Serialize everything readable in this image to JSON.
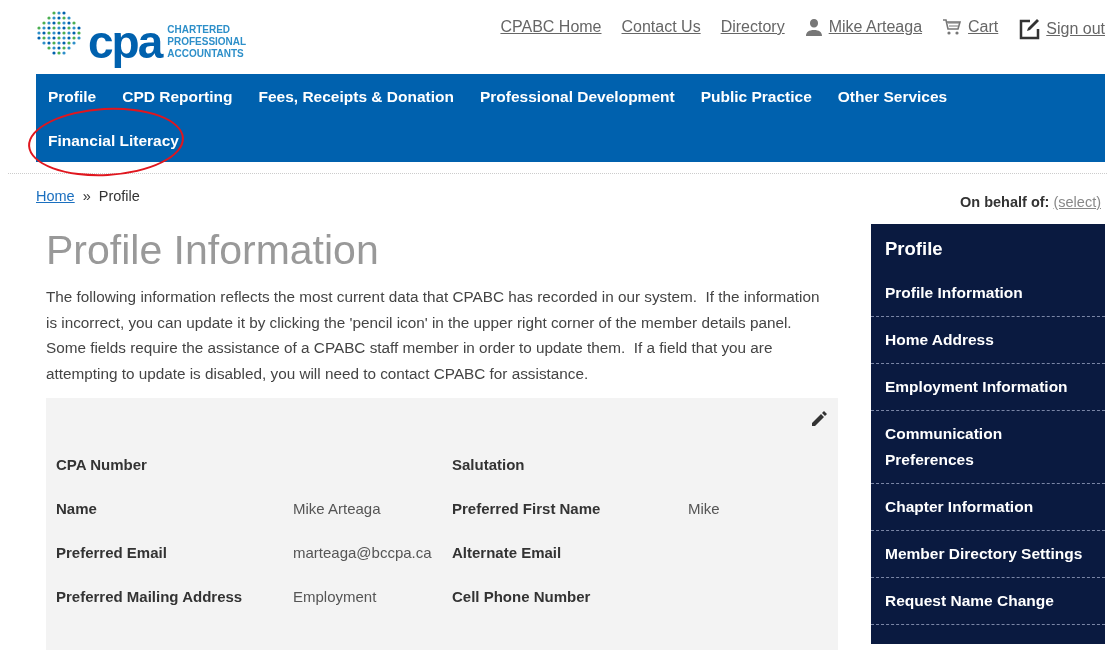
{
  "logo": {
    "wordmark": "cpa",
    "tagline": [
      "CHARTERED",
      "PROFESSIONAL",
      "ACCOUNTANTS"
    ]
  },
  "header_links": [
    {
      "label": "CPABC Home",
      "kind": "plain"
    },
    {
      "label": "Contact Us",
      "kind": "plain"
    },
    {
      "label": "Directory",
      "kind": "plain"
    },
    {
      "label": "Mike Arteaga",
      "kind": "user"
    },
    {
      "label": "Cart",
      "kind": "cart"
    },
    {
      "label": "Sign out",
      "kind": "edit"
    }
  ],
  "nav": [
    {
      "label": "Profile",
      "circled": false
    },
    {
      "label": "CPD Reporting",
      "circled": false
    },
    {
      "label": "Fees, Receipts & Donation",
      "circled": false
    },
    {
      "label": "Professional Development",
      "circled": false
    },
    {
      "label": "Public Practice",
      "circled": false
    },
    {
      "label": "Other Services",
      "circled": false
    },
    {
      "label": "Financial Literacy",
      "circled": true
    }
  ],
  "breadcrumb": {
    "link": "Home",
    "separator": "»",
    "current": "Profile"
  },
  "on_behalf": {
    "label": "On behalf of:",
    "link": "(select)"
  },
  "title": "Profile Information",
  "intro": "The following information reflects the most current data that CPABC has recorded in our system.  If the information is incorrect, you can update it by clicking the 'pencil icon' in the upper right corner of the member details panel.  Some fields require the assistance of a CPABC staff member in order to update them.  If a field that you are attempting to update is disabled, you will need to contact CPABC for assistance.",
  "details": [
    {
      "label": "CPA Number",
      "label_2": "Salutation"
    },
    {
      "label": "Name",
      "value": "Mike Arteaga",
      "label_2": "Preferred First Name",
      "value_2": "Mike"
    },
    {
      "label": "Preferred Email",
      "value": "marteaga@bccpa.ca",
      "label_2": "Alternate Email"
    },
    {
      "label": "Preferred Mailing Address",
      "value": "Employment",
      "label_2": "Cell Phone Number"
    }
  ],
  "sidebar": {
    "heading": "Profile",
    "items": [
      "Profile Information",
      "Home Address",
      "Employment Information",
      "Communication Preferences",
      "Chapter Information",
      "Member Directory Settings",
      "Request Name Change"
    ]
  }
}
